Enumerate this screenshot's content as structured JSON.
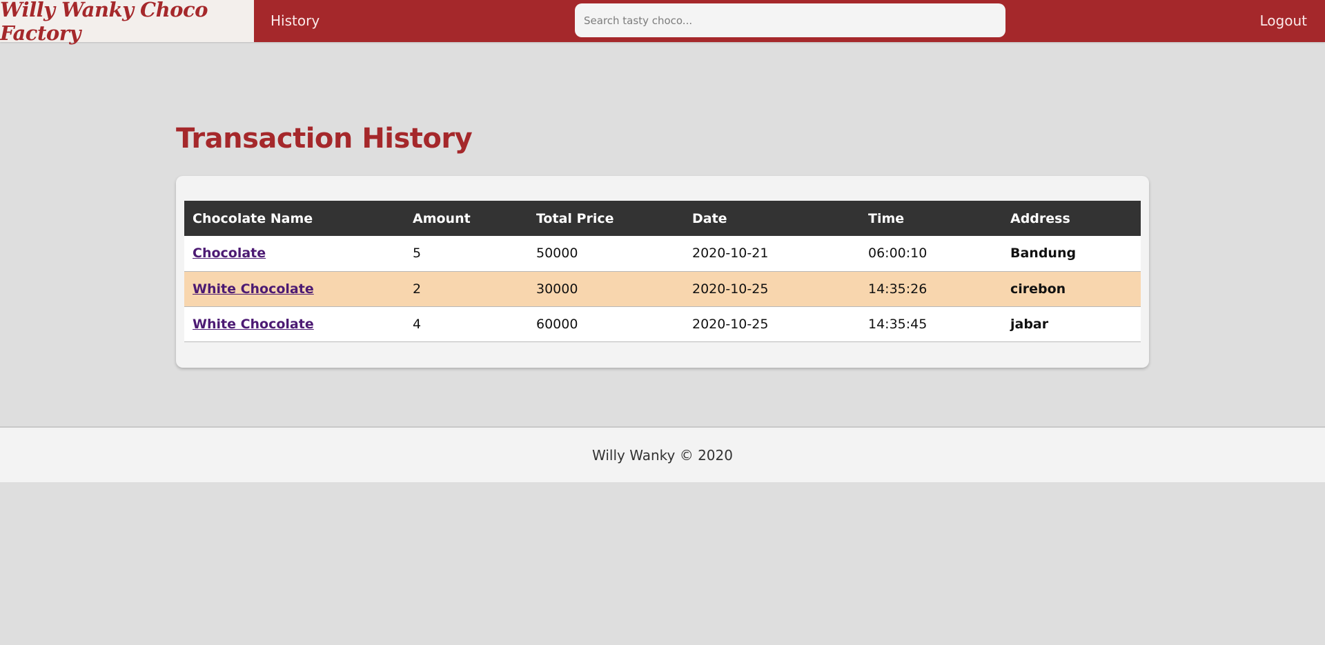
{
  "navbar": {
    "brand": "Willy Wanky Choco Factory",
    "history_label": "History",
    "search_placeholder": "Search tasty choco...",
    "logout_label": "Logout"
  },
  "main": {
    "title": "Transaction History",
    "table": {
      "columns": [
        "Chocolate Name",
        "Amount",
        "Total Price",
        "Date",
        "Time",
        "Address"
      ],
      "rows": [
        [
          "Chocolate",
          "5",
          "50000",
          "2020-10-21",
          "06:00:10",
          "Bandung"
        ],
        [
          "White Chocolate",
          "2",
          "30000",
          "2020-10-25",
          "14:35:26",
          "cirebon"
        ],
        [
          "White Chocolate",
          "4",
          "60000",
          "2020-10-25",
          "14:35:45",
          "jabar"
        ]
      ]
    }
  },
  "footer": {
    "text": "Willy Wanky © 2020"
  },
  "colors": {
    "primary": "#a5282b",
    "header_bg": "#333333",
    "row_highlight": "#f8d6ae",
    "link": "#4c1a73",
    "page_bg": "#dedede"
  }
}
